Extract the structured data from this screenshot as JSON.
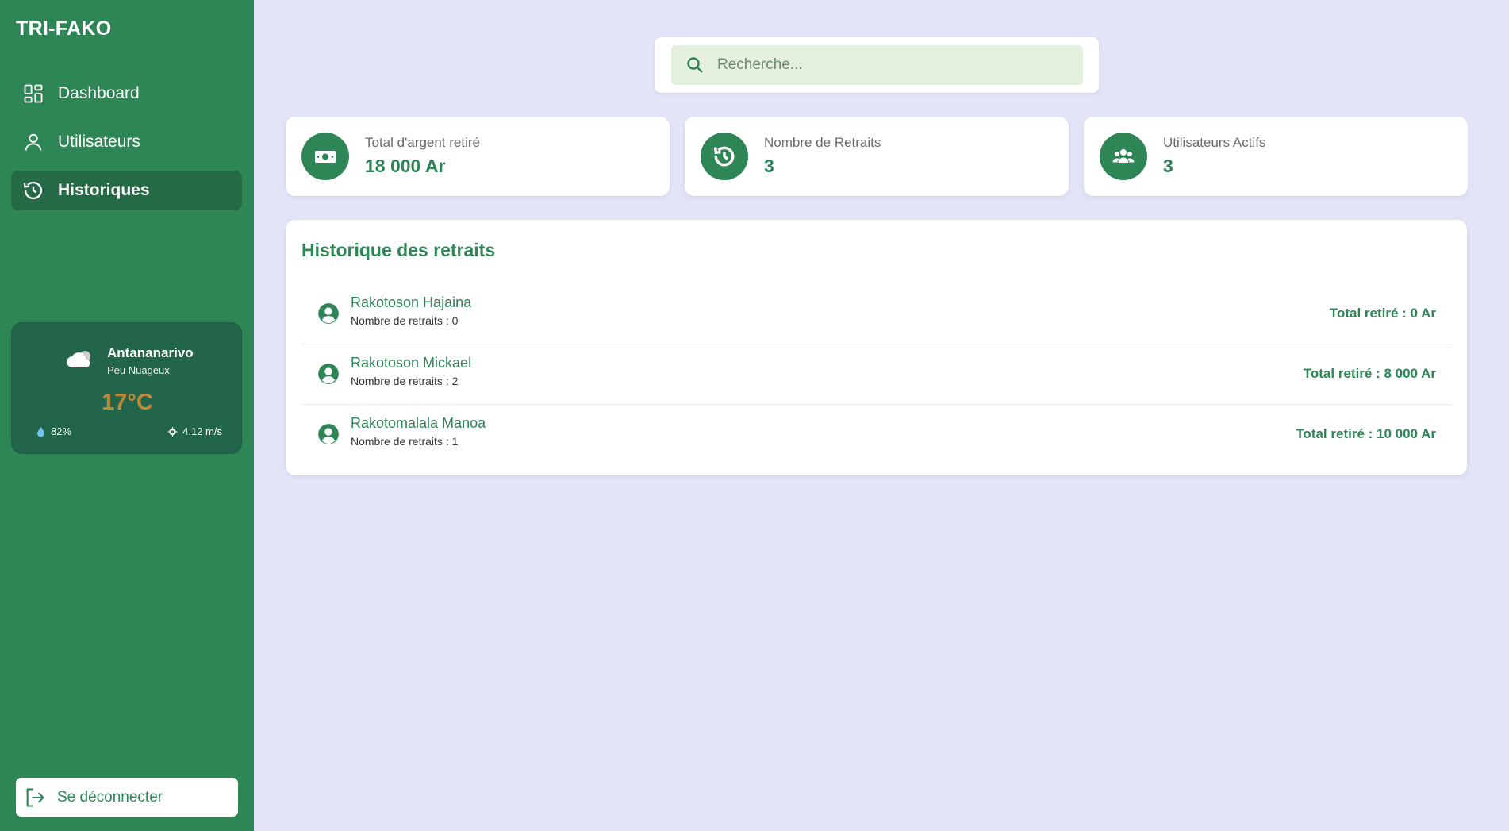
{
  "app": {
    "title": "TRI-FAKO"
  },
  "colors": {
    "primary": "#2e8555",
    "background": "#e3e4f8",
    "accent_temp": "#c18a3a"
  },
  "sidebar": {
    "items": [
      {
        "label": "Dashboard",
        "icon": "dashboard-icon",
        "active": false
      },
      {
        "label": "Utilisateurs",
        "icon": "user-icon",
        "active": false
      },
      {
        "label": "Historiques",
        "icon": "history-icon",
        "active": true
      }
    ],
    "logout_label": "Se déconnecter"
  },
  "weather": {
    "city": "Antananarivo",
    "description": "Peu Nuageux",
    "temperature": "17°C",
    "humidity": "82%",
    "wind": "4.12 m/s",
    "icon": "cloud-icon"
  },
  "search": {
    "placeholder": "Recherche..."
  },
  "stats": [
    {
      "label": "Total d'argent retiré",
      "value": "18 000 Ar",
      "icon": "money-icon"
    },
    {
      "label": "Nombre de Retraits",
      "value": "3",
      "icon": "history-icon"
    },
    {
      "label": "Utilisateurs Actifs",
      "value": "3",
      "icon": "users-icon"
    }
  ],
  "history": {
    "title": "Historique des retraits",
    "rows": [
      {
        "name": "Rakotoson Hajaina",
        "count": "Nombre de retraits : 0",
        "total": "Total retiré : 0 Ar"
      },
      {
        "name": "Rakotoson Mickael",
        "count": "Nombre de retraits : 2",
        "total": "Total retiré : 8 000 Ar"
      },
      {
        "name": "Rakotomalala Manoa",
        "count": "Nombre de retraits : 1",
        "total": "Total retiré : 10 000 Ar"
      }
    ]
  }
}
